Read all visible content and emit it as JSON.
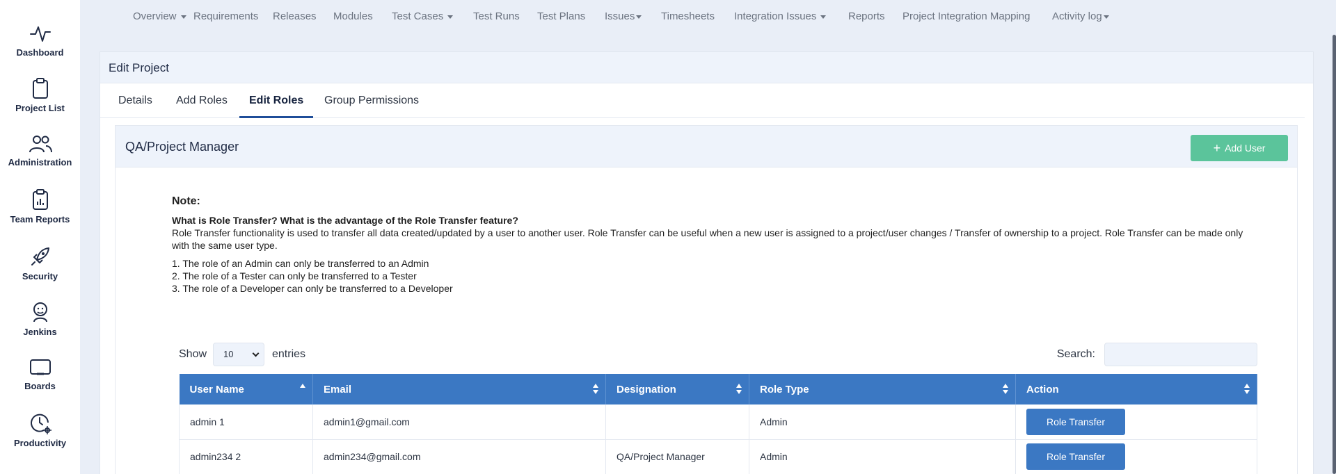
{
  "sidebar": {
    "items": [
      {
        "label": "Dashboard",
        "icon": "activity-icon"
      },
      {
        "label": "Project List",
        "icon": "clipboard-icon"
      },
      {
        "label": "Administration",
        "icon": "users-icon"
      },
      {
        "label": "Team Reports",
        "icon": "report-icon"
      },
      {
        "label": "Security",
        "icon": "rocket-icon"
      },
      {
        "label": "Jenkins",
        "icon": "jenkins-icon"
      },
      {
        "label": "Boards",
        "icon": "board-icon"
      },
      {
        "label": "Productivity",
        "icon": "clock-gear-icon"
      }
    ]
  },
  "topnav": {
    "items": [
      {
        "label": "Overview",
        "dropdown": true
      },
      {
        "label": "Requirements",
        "dropdown": false
      },
      {
        "label": "Releases",
        "dropdown": false
      },
      {
        "label": "Modules",
        "dropdown": false
      },
      {
        "label": "Test Cases",
        "dropdown": true
      },
      {
        "label": "Test Runs",
        "dropdown": false
      },
      {
        "label": "Test Plans",
        "dropdown": false
      },
      {
        "label": "Issues",
        "dropdown": true
      },
      {
        "label": "Timesheets",
        "dropdown": false
      },
      {
        "label": "Integration Issues",
        "dropdown": true
      },
      {
        "label": "Reports",
        "dropdown": false
      },
      {
        "label": "Project Integration Mapping",
        "dropdown": false
      },
      {
        "label": "Activity log",
        "dropdown": true
      }
    ]
  },
  "card": {
    "title": "Edit Project",
    "tabs": [
      {
        "label": "Details",
        "active": false
      },
      {
        "label": "Add Roles",
        "active": false
      },
      {
        "label": "Edit Roles",
        "active": true
      },
      {
        "label": "Group Permissions",
        "active": false
      }
    ]
  },
  "panel": {
    "title": "QA/Project Manager",
    "add_user_label": "Add User"
  },
  "note": {
    "title": "Note:",
    "question": "What is Role Transfer? What is the advantage of the Role Transfer feature?",
    "body": "Role Transfer functionality is used to transfer all data created/updated by a user to another user. Role Transfer can be useful when a new user is assigned to a project/user changes / Transfer of ownership to a project. Role Transfer can be made only with the same user type.",
    "rules": [
      "1. The role of an Admin can only be transferred to an Admin",
      "2. The role of a Tester can only be transferred to a Tester",
      "3. The role of a Developer can only be transferred to a Developer"
    ]
  },
  "table_controls": {
    "show_label": "Show",
    "entries_value": "10",
    "entries_label": "entries",
    "search_label": "Search:"
  },
  "table": {
    "columns": [
      "User Name",
      "Email",
      "Designation",
      "Role Type",
      "Action"
    ],
    "rows": [
      {
        "user_name": "admin 1",
        "email": "admin1@gmail.com",
        "designation": "",
        "role_type": "Admin",
        "action": "Role Transfer"
      },
      {
        "user_name": "admin234 2",
        "email": "admin234@gmail.com",
        "designation": "QA/Project Manager",
        "role_type": "Admin",
        "action": "Role Transfer"
      }
    ]
  },
  "colors": {
    "accent_blue": "#3b78c3",
    "add_user_green": "#5bc49b",
    "page_bg": "#e9eef7"
  }
}
